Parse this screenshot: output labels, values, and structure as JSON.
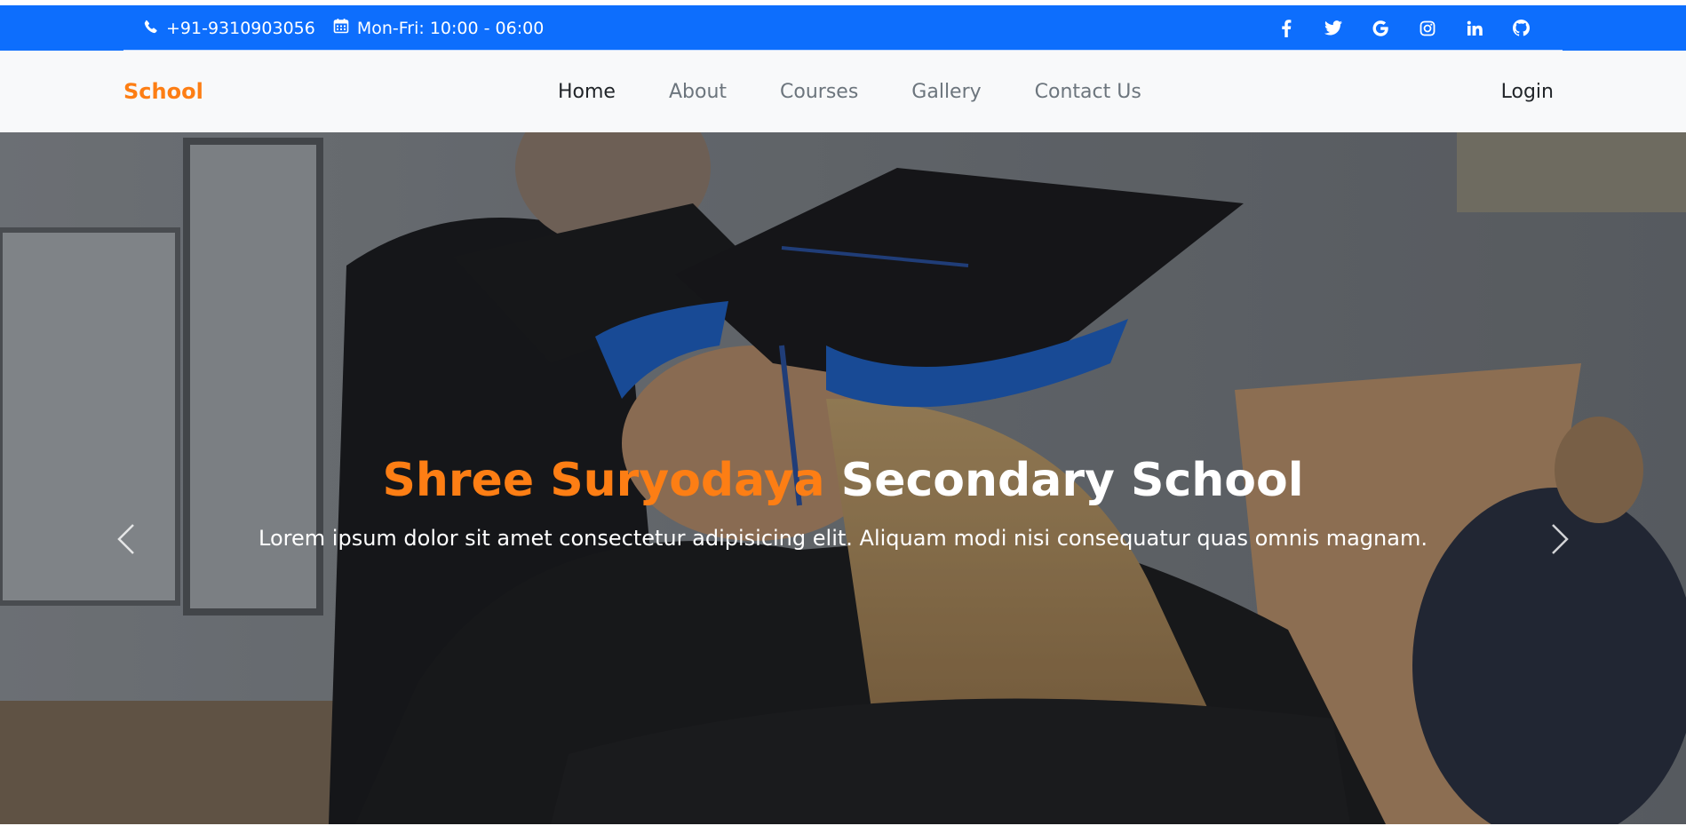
{
  "topbar": {
    "phone": "+91-9310903056",
    "hours": "Mon-Fri: 10:00 - 06:00",
    "phone_icon": "phone-icon",
    "calendar_icon": "calendar-icon",
    "social_icons": [
      "facebook-icon",
      "twitter-icon",
      "google-icon",
      "instagram-icon",
      "linkedin-icon",
      "github-icon"
    ],
    "background": "#0d6efd"
  },
  "navbar": {
    "brand": "School",
    "links": [
      "Home",
      "About",
      "Courses",
      "Gallery",
      "Contact Us"
    ],
    "active_link": "Home",
    "login": "Login",
    "brand_color": "#fd7e14"
  },
  "hero": {
    "title_accent": "Shree Suryodaya",
    "title_rest": "Secondary School",
    "subtitle": "Lorem ipsum dolor sit amet consectetur adipisicing elit. Aliquam modi nisi consequatur quas omnis magnam.",
    "prev_icon": "chevron-left-icon",
    "next_icon": "chevron-right-icon"
  }
}
